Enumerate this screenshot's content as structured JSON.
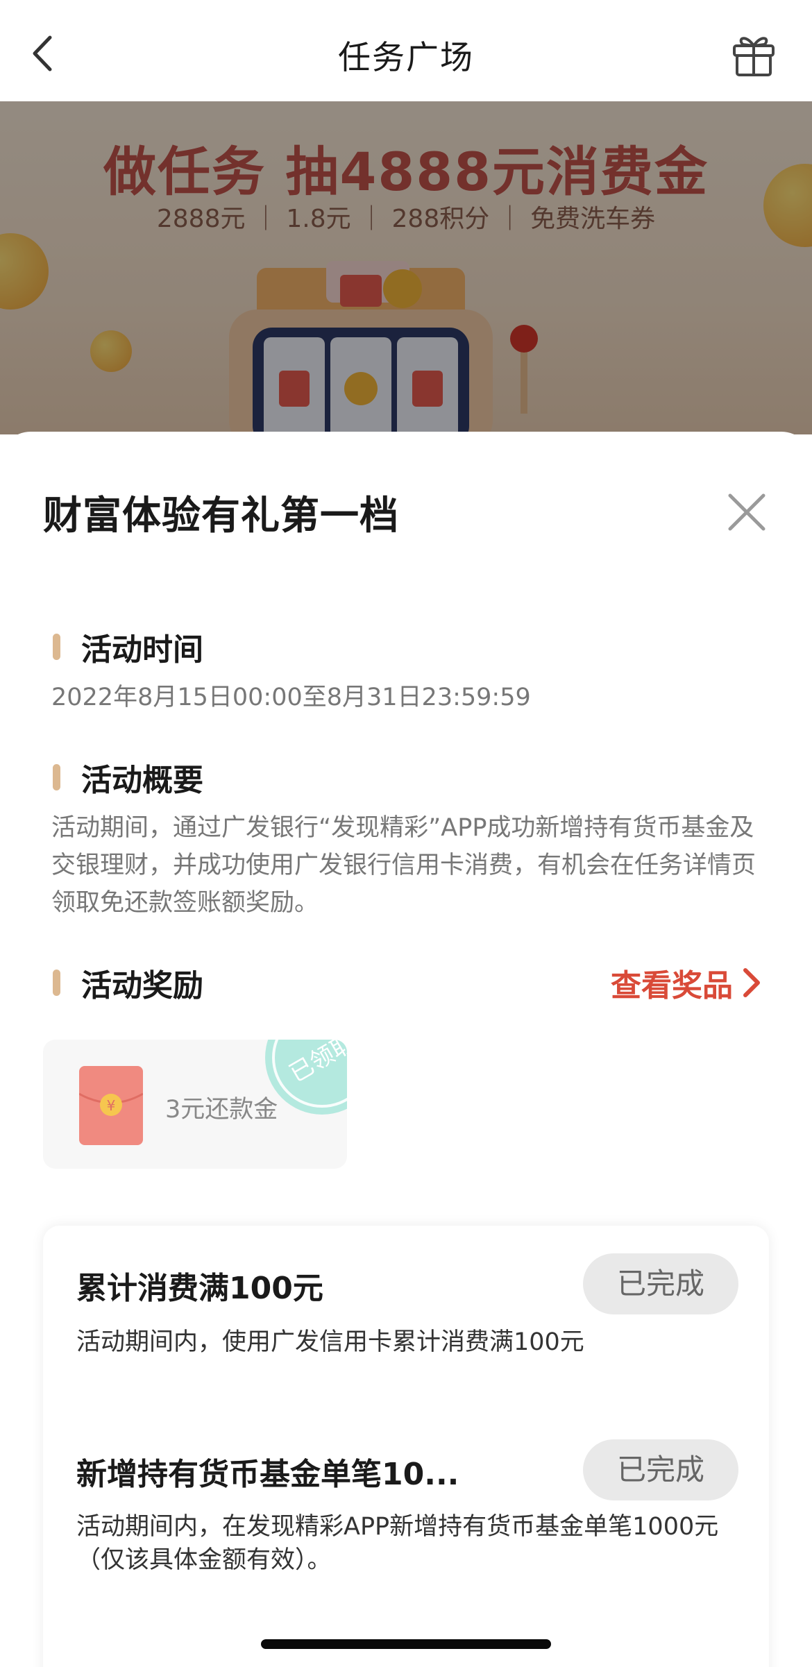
{
  "navbar": {
    "title": "任务广场"
  },
  "banner": {
    "headline": "做任务 抽4888元消费金",
    "subline": "2888元 ｜ 1.8元 ｜ 288积分 ｜ 免费洗车券"
  },
  "sheet": {
    "title": "财富体验有礼第一档",
    "sections": {
      "time": {
        "label": "活动时间",
        "text": "2022年8月15日00:00至8月31日23:59:59"
      },
      "summary": {
        "label": "活动概要",
        "text": "活动期间，通过广发银行“发现精彩”APP成功新增持有货币基金及交银理财，并成功使用广发银行信用卡消费，有机会在任务详情页领取免还款签账额奖励。"
      },
      "reward": {
        "label": "活动奖励",
        "link_label": "查看奖品"
      }
    },
    "reward_card": {
      "label": "3元还款金",
      "stamp_text": "已领取",
      "packet_symbol": "¥"
    },
    "tasks": [
      {
        "title": "累计消费满100元",
        "desc": "活动期间内，使用广发信用卡累计消费满100元",
        "status": "已完成"
      },
      {
        "title": "新增持有货币基金单笔10...",
        "desc": "活动期间内，在发现精彩APP新增持有货币基金单笔1000元（仅该具体金额有效）。",
        "status": "已完成"
      }
    ]
  },
  "colors": {
    "accent_red": "#d94a38",
    "section_bar": "#dcb890",
    "stamp_teal": "#7fd8c8",
    "redpacket": "#f08a80"
  }
}
